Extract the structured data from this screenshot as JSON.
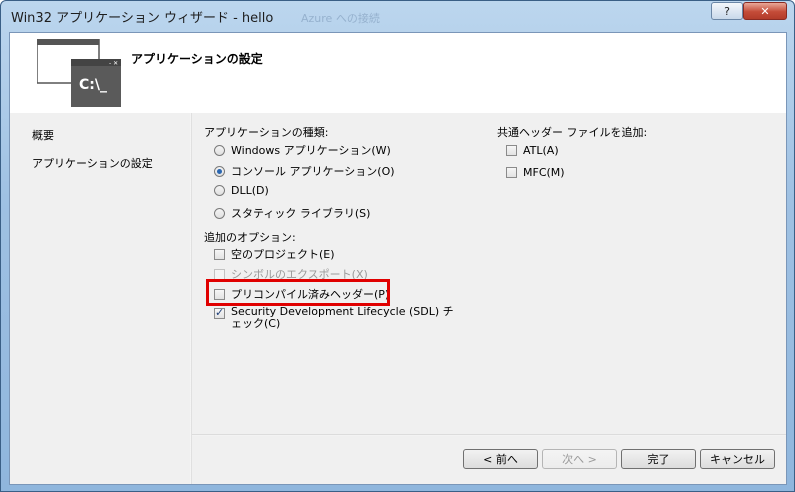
{
  "window": {
    "title": "Win32 アプリケーション ウィザード - hello",
    "ghost_title": "Azure への接続",
    "help_label": "?",
    "close_label": "✕"
  },
  "header": {
    "title": "アプリケーションの設定",
    "icon_text": "C:\\_"
  },
  "nav": {
    "items": [
      {
        "label": "概要"
      },
      {
        "label": "アプリケーションの設定"
      }
    ]
  },
  "app_type": {
    "label": "アプリケーションの種類:",
    "options": [
      {
        "label": "Windows アプリケーション(W)",
        "selected": false
      },
      {
        "label": "コンソール アプリケーション(O)",
        "selected": true
      },
      {
        "label": "DLL(D)",
        "selected": false
      },
      {
        "label": "スタティック ライブラリ(S)",
        "selected": false
      }
    ]
  },
  "extra_options": {
    "label": "追加のオプション:",
    "items": [
      {
        "label": "空のプロジェクト(E)",
        "checked": false,
        "enabled": true
      },
      {
        "label": "シンボルのエクスポート(X)",
        "checked": false,
        "enabled": false
      },
      {
        "label": "プリコンパイル済みヘッダー(P)",
        "checked": false,
        "enabled": true
      },
      {
        "label": "Security Development Lifecycle (SDL) チェック(C)",
        "checked": true,
        "enabled": true
      }
    ]
  },
  "common_headers": {
    "label": "共通ヘッダー ファイルを追加:",
    "items": [
      {
        "label": "ATL(A)",
        "checked": false
      },
      {
        "label": "MFC(M)",
        "checked": false
      }
    ]
  },
  "buttons": {
    "prev": "< 前へ",
    "next": "次へ >",
    "finish": "完了",
    "cancel": "キャンセル"
  }
}
